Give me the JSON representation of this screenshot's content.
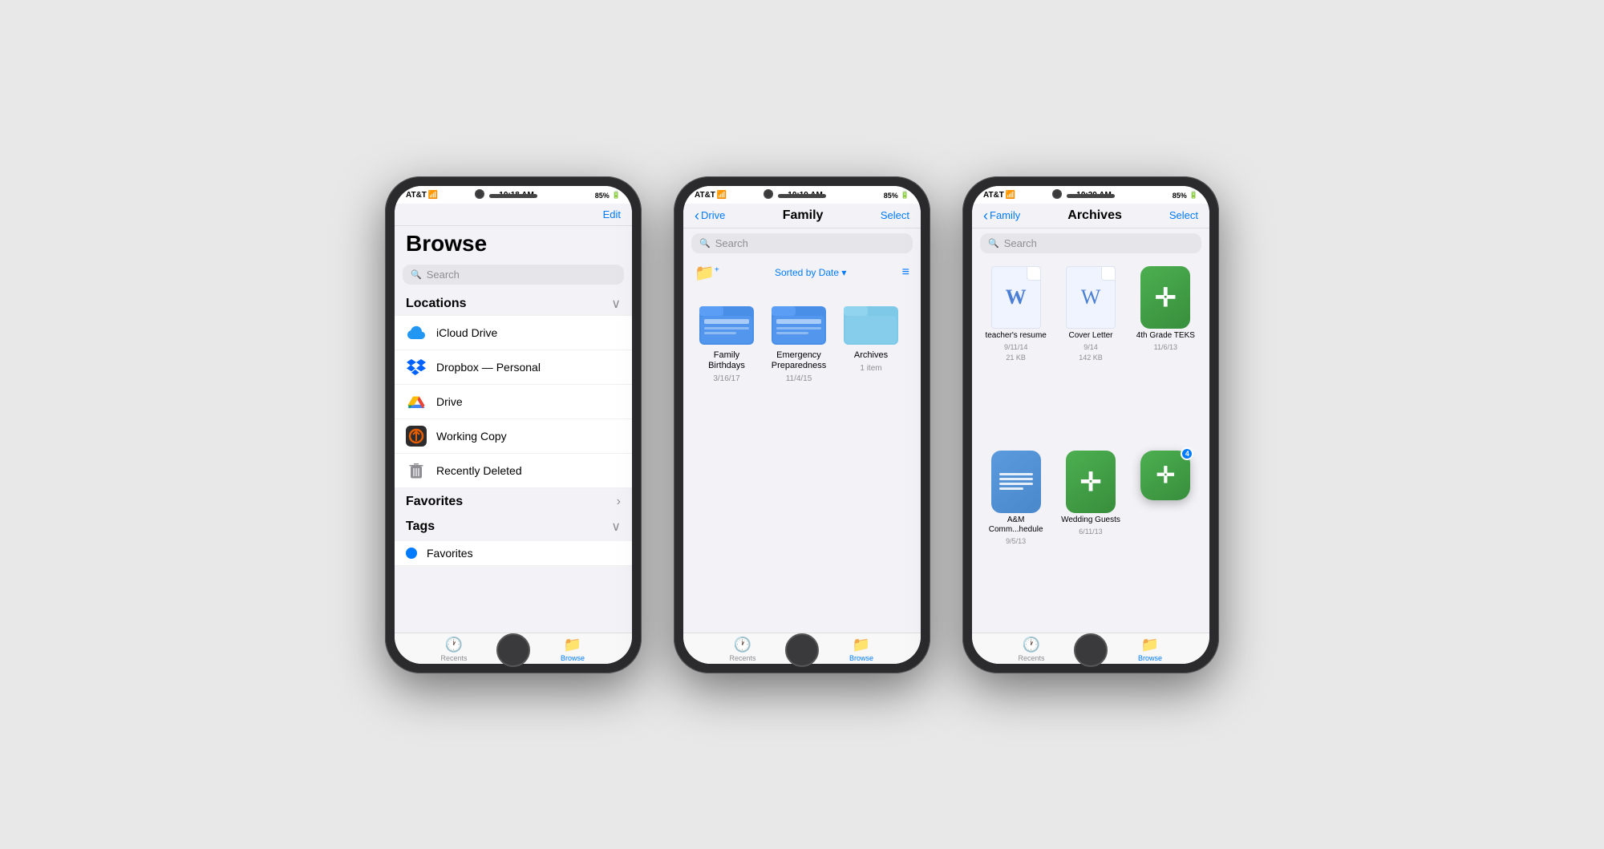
{
  "background": "#e8e8e8",
  "phones": [
    {
      "id": "phone1",
      "statusBar": {
        "carrier": "AT&T",
        "time": "10:18 AM",
        "battery": "85%"
      },
      "screen": "browse",
      "browse": {
        "navEdit": "Edit",
        "title": "Browse",
        "searchPlaceholder": "Search",
        "locationsLabel": "Locations",
        "items": [
          {
            "label": "iCloud Drive",
            "icon": "icloud"
          },
          {
            "label": "Dropbox — Personal",
            "icon": "dropbox"
          },
          {
            "label": "Drive",
            "icon": "drive"
          },
          {
            "label": "Working Copy",
            "icon": "workingcopy"
          },
          {
            "label": "Recently Deleted",
            "icon": "trash"
          }
        ],
        "favoritesLabel": "Favorites",
        "tagsLabel": "Tags",
        "tagItems": [
          {
            "label": "Favorites",
            "color": "#007aff"
          }
        ]
      },
      "tabBar": {
        "recents": "Recents",
        "browse": "Browse",
        "activeTab": "browse"
      }
    },
    {
      "id": "phone2",
      "statusBar": {
        "carrier": "AT&T",
        "time": "10:19 AM",
        "battery": "85%"
      },
      "screen": "family",
      "family": {
        "backLabel": "Drive",
        "title": "Family",
        "selectLabel": "Select",
        "searchPlaceholder": "Search",
        "sortLabel": "Sorted by Date ▾",
        "folders": [
          {
            "name": "Family Birthdays",
            "date": "3/16/17",
            "type": "folder-blue"
          },
          {
            "name": "Emergency Preparedness",
            "date": "11/4/15",
            "type": "folder-blue"
          },
          {
            "name": "Archives",
            "date": "1 item",
            "type": "folder-light"
          }
        ]
      },
      "tabBar": {
        "recents": "Recents",
        "browse": "Browse",
        "activeTab": "browse"
      }
    },
    {
      "id": "phone3",
      "statusBar": {
        "carrier": "AT&T",
        "time": "10:20 AM",
        "battery": "85%"
      },
      "screen": "archives",
      "archives": {
        "backLabel": "Family",
        "title": "Archives",
        "selectLabel": "Select",
        "searchPlaceholder": "Search",
        "items": [
          {
            "name": "teacher's resume",
            "date": "9/11/14",
            "size": "21 KB",
            "type": "doc-w-bold"
          },
          {
            "name": "Cover Letter",
            "date": "9/14",
            "size": "142 KB",
            "type": "doc-w-outline"
          },
          {
            "name": "4th Grade TEKS",
            "date": "11/6/13",
            "type": "cross-green"
          },
          {
            "name": "A&M Comm...hedule",
            "date": "9/5/13",
            "type": "blue-doc"
          },
          {
            "name": "Wedding Guests",
            "date": "6/11/13",
            "type": "cross-green"
          },
          {
            "name": "",
            "date": "",
            "type": "cross-green-float",
            "badge": "4"
          }
        ]
      },
      "tabBar": {
        "recents": "Recents",
        "browse": "Browse",
        "activeTab": "browse"
      }
    }
  ]
}
